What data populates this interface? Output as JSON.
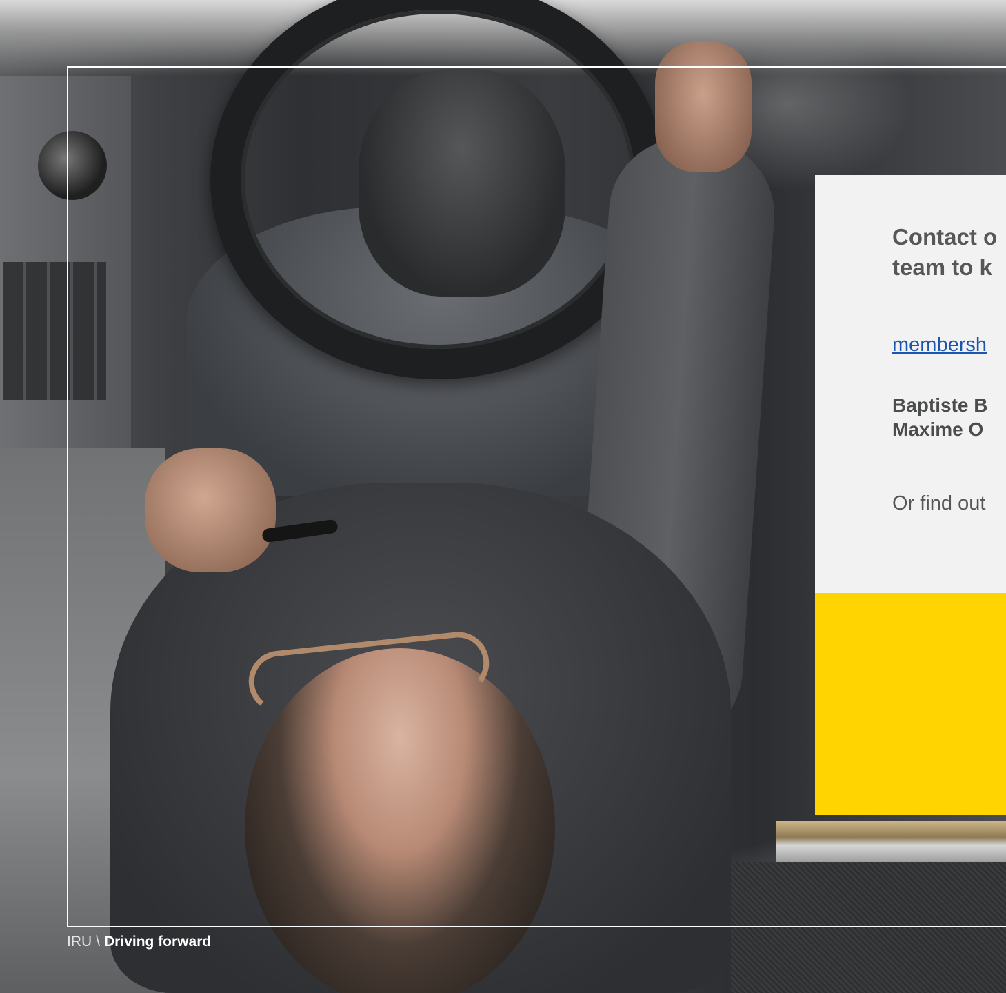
{
  "card": {
    "headline_line1": "Contact o",
    "headline_line2": "team to k",
    "email_link": "membersh",
    "contacts": [
      "Baptiste B",
      "Maxime O"
    ],
    "more_text": "Or find out"
  },
  "footer": {
    "brand": "IRU",
    "separator": "\\",
    "tagline": "Driving forward"
  },
  "colors": {
    "accent_yellow": "#ffd400",
    "card_bg": "#f2f2f2",
    "link_blue": "#1a56b0",
    "frame": "#ffffff"
  }
}
